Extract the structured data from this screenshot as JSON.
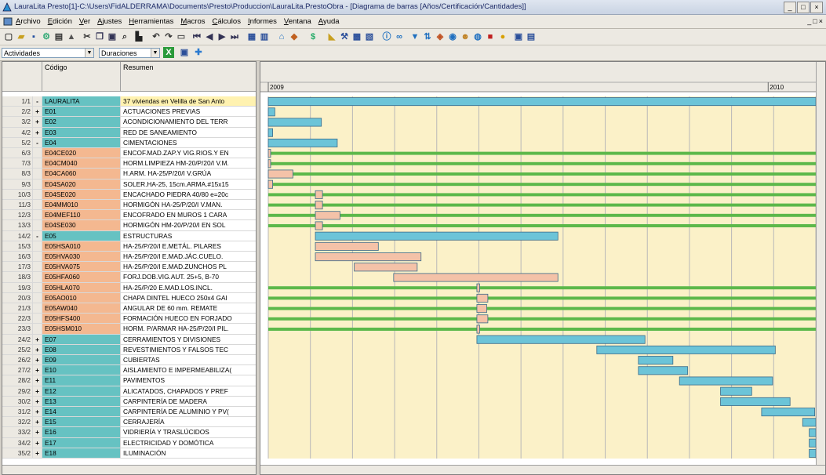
{
  "window": {
    "title": "LauraLita Presto[1]-C:\\Users\\FidALDERRAMA\\Documents\\Presto\\Produccion\\LauraLita.PrestoObra - [Diagrama de barras [Años/Certificación/Cantidades]]",
    "buttons": [
      "_",
      "□",
      "×"
    ]
  },
  "menu": {
    "items": [
      "Archivo",
      "Edición",
      "Ver",
      "Ajustes",
      "Herramientas",
      "Macros",
      "Cálculos",
      "Informes",
      "Ventana",
      "Ayuda"
    ],
    "mdi_buttons": [
      "_",
      "□",
      "×"
    ]
  },
  "toolbar2": {
    "view_select": "Actividades",
    "duration_select": "Duraciones"
  },
  "table": {
    "headers": {
      "code": "Código",
      "summary": "Resumen"
    },
    "rows": [
      {
        "num": "1/1",
        "exp": "-",
        "code": "LAURALITA",
        "summary": "37 viviendas en Velilla de San Anto",
        "color": "teal",
        "res_color": "yellow"
      },
      {
        "num": "2/2",
        "exp": "+",
        "code": "E01",
        "summary": "ACTUACIONES PREVIAS",
        "color": "teal"
      },
      {
        "num": "3/2",
        "exp": "+",
        "code": "E02",
        "summary": "ACONDICIONAMIENTO DEL TERR",
        "color": "teal"
      },
      {
        "num": "4/2",
        "exp": "+",
        "code": "E03",
        "summary": "RED DE SANEAMIENTO",
        "color": "teal"
      },
      {
        "num": "5/2",
        "exp": "-",
        "code": "E04",
        "summary": "CIMENTACIONES",
        "color": "teal"
      },
      {
        "num": "6/3",
        "exp": "",
        "code": "E04CE020",
        "summary": "ENCOF.MAD.ZAP.Y VIG.RIOS.Y EN",
        "color": "salmon"
      },
      {
        "num": "7/3",
        "exp": "",
        "code": "E04CM040",
        "summary": "HORM.LIMPIEZA HM-20/P/20/I V.M.",
        "color": "salmon"
      },
      {
        "num": "8/3",
        "exp": "",
        "code": "E04CA060",
        "summary": "H.ARM. HA-25/P/20/I V.GRÚA",
        "color": "salmon"
      },
      {
        "num": "9/3",
        "exp": "",
        "code": "E04SA020",
        "summary": "SOLER.HA-25, 15cm.ARMA.#15x15",
        "color": "salmon"
      },
      {
        "num": "10/3",
        "exp": "",
        "code": "E04SE020",
        "summary": "ENCACHADO PIEDRA 40/80 e=20c",
        "color": "salmon"
      },
      {
        "num": "11/3",
        "exp": "",
        "code": "E04MM010",
        "summary": "HORMIGÓN HA-25/P/20/I V.MAN.",
        "color": "salmon"
      },
      {
        "num": "12/3",
        "exp": "",
        "code": "E04MEF110",
        "summary": "ENCOFRADO EN MUROS 1 CARA",
        "color": "salmon"
      },
      {
        "num": "13/3",
        "exp": "",
        "code": "E04SE030",
        "summary": "HORMIGÓN HM-20/P/20/I EN SOL",
        "color": "salmon"
      },
      {
        "num": "14/2",
        "exp": "-",
        "code": "E05",
        "summary": "ESTRUCTURAS",
        "color": "teal"
      },
      {
        "num": "15/3",
        "exp": "",
        "code": "E05HSA010",
        "summary": "HA-25/P/20/I E.METÁL. PILARES",
        "color": "salmon"
      },
      {
        "num": "16/3",
        "exp": "",
        "code": "E05HVA030",
        "summary": "HA-25/P/20/I E.MAD.JÁC.CUELO.",
        "color": "salmon"
      },
      {
        "num": "17/3",
        "exp": "",
        "code": "E05HVA075",
        "summary": "HA-25/P/20/I E.MAD.ZUNCHOS PL",
        "color": "salmon"
      },
      {
        "num": "18/3",
        "exp": "",
        "code": "E05HFA060",
        "summary": "FORJ.DOB.VIG.AUT. 25+5, B-70",
        "color": "salmon"
      },
      {
        "num": "19/3",
        "exp": "",
        "code": "E05HLA070",
        "summary": "HA-25/P/20 E.MAD.LOS.INCL.",
        "color": "salmon"
      },
      {
        "num": "20/3",
        "exp": "",
        "code": "E05AO010",
        "summary": "CHAPA DINTEL HUECO 250x4 GAI",
        "color": "salmon"
      },
      {
        "num": "21/3",
        "exp": "",
        "code": "E05AW040",
        "summary": "ANGULAR DE 60 mm. REMATE",
        "color": "salmon"
      },
      {
        "num": "22/3",
        "exp": "",
        "code": "E05HFS400",
        "summary": "FORMACIÓN HUECO EN FORJADO",
        "color": "salmon"
      },
      {
        "num": "23/3",
        "exp": "",
        "code": "E05HSM010",
        "summary": "HORM. P/ARMAR HA-25/P/20/I PIL.",
        "color": "salmon"
      },
      {
        "num": "24/2",
        "exp": "+",
        "code": "E07",
        "summary": "CERRAMIENTOS Y DIVISIONES",
        "color": "teal"
      },
      {
        "num": "25/2",
        "exp": "+",
        "code": "E08",
        "summary": "REVESTIMIENTOS Y FALSOS TEC",
        "color": "teal"
      },
      {
        "num": "26/2",
        "exp": "+",
        "code": "E09",
        "summary": "CUBIERTAS",
        "color": "teal"
      },
      {
        "num": "27/2",
        "exp": "+",
        "code": "E10",
        "summary": "AISLAMIENTO E IMPERMEABILIZA(",
        "color": "teal"
      },
      {
        "num": "28/2",
        "exp": "+",
        "code": "E11",
        "summary": "PAVIMENTOS",
        "color": "teal"
      },
      {
        "num": "29/2",
        "exp": "+",
        "code": "E12",
        "summary": "ALICATADOS, CHAPADOS Y PREF",
        "color": "teal"
      },
      {
        "num": "30/2",
        "exp": "+",
        "code": "E13",
        "summary": "CARPINTERÍA DE MADERA",
        "color": "teal"
      },
      {
        "num": "31/2",
        "exp": "+",
        "code": "E14",
        "summary": "CARPINTERÍA DE ALUMINIO Y PV(",
        "color": "teal"
      },
      {
        "num": "32/2",
        "exp": "+",
        "code": "E15",
        "summary": "CERRAJERÍA",
        "color": "teal"
      },
      {
        "num": "33/2",
        "exp": "+",
        "code": "E16",
        "summary": "VIDRIERÍA Y TRASLÚCIDOS",
        "color": "teal"
      },
      {
        "num": "34/2",
        "exp": "+",
        "code": "E17",
        "summary": "ELECTRICIDAD Y DOMÓTICA",
        "color": "teal"
      },
      {
        "num": "35/2",
        "exp": "+",
        "code": "E18",
        "summary": "ILUMINACIÓN",
        "color": "teal"
      }
    ]
  },
  "gantt": {
    "years": [
      "2009",
      "2010"
    ],
    "colors": {
      "summary_bar": "#6cc4d8",
      "task_bar": "#f4c2a8",
      "progress": "#5cb84a",
      "background": "#fbf1c8",
      "grid": "#b8b8b8"
    },
    "bars": [
      {
        "row": 0,
        "type": "summary",
        "start": 0.0,
        "end": 1.0,
        "progress": false
      },
      {
        "row": 1,
        "type": "summary",
        "start": 0.0,
        "end": 0.012,
        "progress": false
      },
      {
        "row": 2,
        "type": "summary",
        "start": 0.0,
        "end": 0.097,
        "progress": false
      },
      {
        "row": 3,
        "type": "summary",
        "start": 0.0,
        "end": 0.008,
        "progress": false
      },
      {
        "row": 4,
        "type": "summary",
        "start": 0.0,
        "end": 0.126,
        "progress": false
      },
      {
        "row": 5,
        "type": "task",
        "start": 0.0,
        "end": 0.004,
        "progress": true
      },
      {
        "row": 6,
        "type": "task",
        "start": 0.0,
        "end": 0.004,
        "progress": true
      },
      {
        "row": 7,
        "type": "task",
        "start": 0.0,
        "end": 0.045,
        "progress": true
      },
      {
        "row": 8,
        "type": "task",
        "start": 0.0,
        "end": 0.008,
        "progress": true
      },
      {
        "row": 9,
        "type": "task",
        "start": 0.086,
        "end": 0.099,
        "progress": true
      },
      {
        "row": 10,
        "type": "task",
        "start": 0.086,
        "end": 0.099,
        "progress": true
      },
      {
        "row": 11,
        "type": "task",
        "start": 0.086,
        "end": 0.131,
        "progress": true
      },
      {
        "row": 12,
        "type": "task",
        "start": 0.086,
        "end": 0.099,
        "progress": true
      },
      {
        "row": 13,
        "type": "summary",
        "start": 0.086,
        "end": 0.529,
        "progress": false
      },
      {
        "row": 14,
        "type": "task",
        "start": 0.086,
        "end": 0.201,
        "progress": false
      },
      {
        "row": 15,
        "type": "task",
        "start": 0.086,
        "end": 0.279,
        "progress": false
      },
      {
        "row": 16,
        "type": "task",
        "start": 0.157,
        "end": 0.272,
        "progress": false
      },
      {
        "row": 17,
        "type": "task",
        "start": 0.229,
        "end": 0.529,
        "progress": false
      },
      {
        "row": 18,
        "type": "task",
        "start": 0.381,
        "end": 0.386,
        "progress": true
      },
      {
        "row": 19,
        "type": "task",
        "start": 0.381,
        "end": 0.401,
        "progress": true
      },
      {
        "row": 20,
        "type": "task",
        "start": 0.381,
        "end": 0.399,
        "progress": true
      },
      {
        "row": 21,
        "type": "task",
        "start": 0.381,
        "end": 0.401,
        "progress": true
      },
      {
        "row": 22,
        "type": "task",
        "start": 0.381,
        "end": 0.386,
        "progress": true
      },
      {
        "row": 23,
        "type": "summary",
        "start": 0.381,
        "end": 0.688,
        "progress": false
      },
      {
        "row": 24,
        "type": "summary",
        "start": 0.6,
        "end": 0.926,
        "progress": false
      },
      {
        "row": 25,
        "type": "summary",
        "start": 0.676,
        "end": 0.739,
        "progress": false
      },
      {
        "row": 26,
        "type": "summary",
        "start": 0.676,
        "end": 0.766,
        "progress": false
      },
      {
        "row": 27,
        "type": "summary",
        "start": 0.751,
        "end": 0.921,
        "progress": false
      },
      {
        "row": 28,
        "type": "summary",
        "start": 0.826,
        "end": 0.883,
        "progress": false
      },
      {
        "row": 29,
        "type": "summary",
        "start": 0.826,
        "end": 0.953,
        "progress": false
      },
      {
        "row": 30,
        "type": "summary",
        "start": 0.901,
        "end": 0.998,
        "progress": false
      },
      {
        "row": 31,
        "type": "summary",
        "start": 0.976,
        "end": 1.0,
        "progress": false
      },
      {
        "row": 32,
        "type": "summary",
        "start": 0.988,
        "end": 1.0,
        "progress": false
      },
      {
        "row": 33,
        "type": "summary",
        "start": 0.988,
        "end": 1.0,
        "progress": false
      },
      {
        "row": 34,
        "type": "summary",
        "start": 0.988,
        "end": 1.0,
        "progress": false
      }
    ]
  }
}
